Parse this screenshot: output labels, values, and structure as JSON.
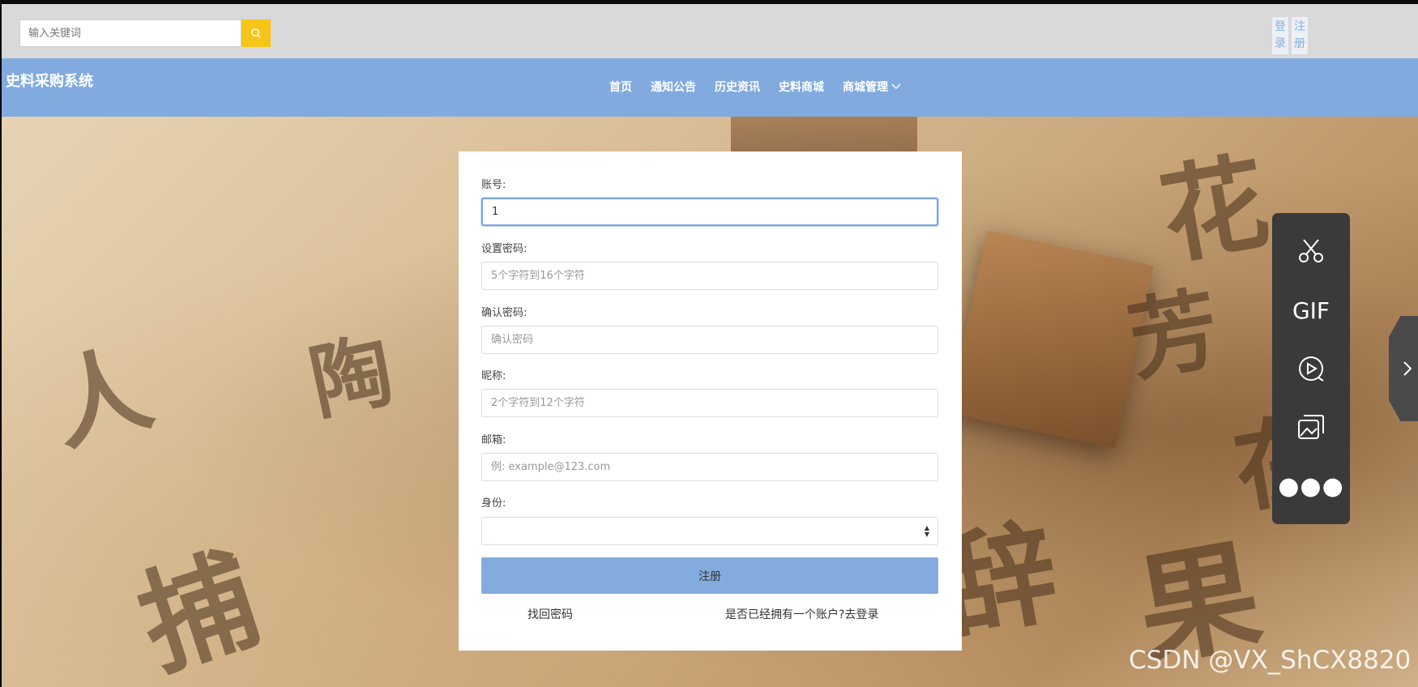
{
  "search": {
    "placeholder": "输入关键词"
  },
  "auth": {
    "login": "登录",
    "login_top": "登",
    "login_bottom": "录",
    "register_top": "注",
    "register_bottom": "册"
  },
  "brand": "史料采购系统",
  "nav": {
    "items": [
      "首页",
      "通知公告",
      "历史资讯",
      "史料商城",
      "商城管理"
    ]
  },
  "form": {
    "account_label": "账号:",
    "account_value": "1",
    "password_label": "设置密码:",
    "password_placeholder": "5个字符到16个字符",
    "confirm_label": "确认密码:",
    "confirm_placeholder": "确认密码",
    "nickname_label": "昵称:",
    "nickname_placeholder": "2个字符到12个字符",
    "email_label": "邮箱:",
    "email_placeholder": "例: example@123.com",
    "role_label": "身份:",
    "submit_label": "注册",
    "forgot_label": "找回密码",
    "login_link_label": "是否已经拥有一个账户?去登录"
  },
  "tools": {
    "gif_label": "GIF"
  },
  "watermark": "CSDN @VX_ShCX8820",
  "colors": {
    "nav_bg": "#81abdf",
    "search_button": "#f5c518",
    "submit_bg": "#84abde",
    "toolbar_bg": "#3a3a3a"
  }
}
